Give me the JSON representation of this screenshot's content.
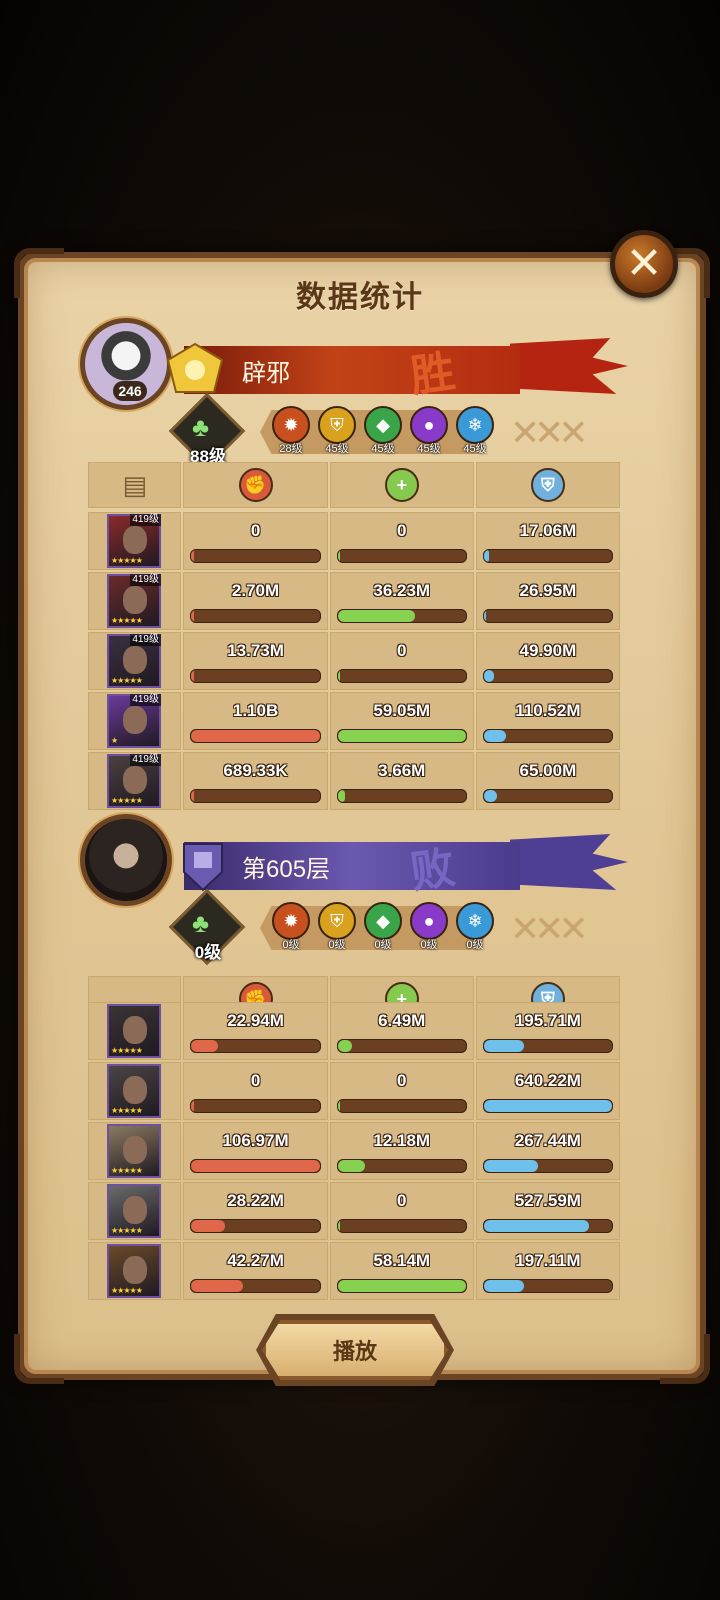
{
  "title": "数据统计",
  "play_label": "播放",
  "colors": {
    "damage": "#e0674a",
    "heal": "#86d14f",
    "shield": "#6fc1ec"
  },
  "teams": [
    {
      "avatar_level": "246",
      "banner_name": "辟邪",
      "result": "胜",
      "tree_level": "88级",
      "factions": [
        {
          "icon": "fire-faction-icon",
          "color": "#c8501e",
          "level": "28级"
        },
        {
          "icon": "shield-faction-icon",
          "color": "#d9a21e",
          "level": "45级"
        },
        {
          "icon": "leaf-faction-icon",
          "color": "#3aa548",
          "level": "45级"
        },
        {
          "icon": "dark-faction-icon",
          "color": "#8a3ac8",
          "level": "45级"
        },
        {
          "icon": "ice-faction-icon",
          "color": "#3a9ad8",
          "level": "45级"
        }
      ],
      "heroes": [
        {
          "level": "419级",
          "stars": "★★★★★",
          "damage": "0",
          "heal": "0",
          "shield": "17.06M",
          "damage_ratio": 0.0,
          "heal_ratio": 0.0,
          "shield_ratio": 0.04
        },
        {
          "level": "419级",
          "stars": "★★★★★",
          "damage": "2.70M",
          "heal": "36.23M",
          "shield": "26.95M",
          "damage_ratio": 0.0,
          "heal_ratio": 0.6,
          "shield_ratio": 0.02
        },
        {
          "level": "419级",
          "stars": "★★★★★",
          "damage": "13.73M",
          "heal": "0",
          "shield": "49.90M",
          "damage_ratio": 0.01,
          "heal_ratio": 0.0,
          "shield_ratio": 0.08
        },
        {
          "level": "419级",
          "stars": "★",
          "damage": "1.10B",
          "heal": "59.05M",
          "shield": "110.52M",
          "damage_ratio": 1.0,
          "heal_ratio": 1.0,
          "shield_ratio": 0.17
        },
        {
          "level": "419级",
          "stars": "★★★★★",
          "damage": "689.33K",
          "heal": "3.66M",
          "shield": "65.00M",
          "damage_ratio": 0.0,
          "heal_ratio": 0.06,
          "shield_ratio": 0.1
        }
      ]
    },
    {
      "avatar_level": "",
      "banner_name": "第605层",
      "result": "败",
      "tree_level": "0级",
      "factions": [
        {
          "icon": "fire-faction-icon",
          "color": "#c8501e",
          "level": "0级"
        },
        {
          "icon": "shield-faction-icon",
          "color": "#d9a21e",
          "level": "0级"
        },
        {
          "icon": "leaf-faction-icon",
          "color": "#3aa548",
          "level": "0级"
        },
        {
          "icon": "dark-faction-icon",
          "color": "#8a3ac8",
          "level": "0级"
        },
        {
          "icon": "ice-faction-icon",
          "color": "#3a9ad8",
          "level": "0级"
        }
      ],
      "heroes": [
        {
          "level": "",
          "stars": "★★★★★",
          "damage": "22.94M",
          "heal": "6.49M",
          "shield": "195.71M",
          "damage_ratio": 0.21,
          "heal_ratio": 0.11,
          "shield_ratio": 0.31
        },
        {
          "level": "",
          "stars": "★★★★★",
          "damage": "0",
          "heal": "0",
          "shield": "640.22M",
          "damage_ratio": 0.0,
          "heal_ratio": 0.0,
          "shield_ratio": 1.0
        },
        {
          "level": "",
          "stars": "★★★★★",
          "damage": "106.97M",
          "heal": "12.18M",
          "shield": "267.44M",
          "damage_ratio": 1.0,
          "heal_ratio": 0.21,
          "shield_ratio": 0.42
        },
        {
          "level": "",
          "stars": "★★★★★",
          "damage": "28.22M",
          "heal": "0",
          "shield": "527.59M",
          "damage_ratio": 0.26,
          "heal_ratio": 0.0,
          "shield_ratio": 0.82
        },
        {
          "level": "",
          "stars": "★★★★★",
          "damage": "42.27M",
          "heal": "58.14M",
          "shield": "197.11M",
          "damage_ratio": 0.4,
          "heal_ratio": 1.0,
          "shield_ratio": 0.31
        }
      ]
    }
  ]
}
